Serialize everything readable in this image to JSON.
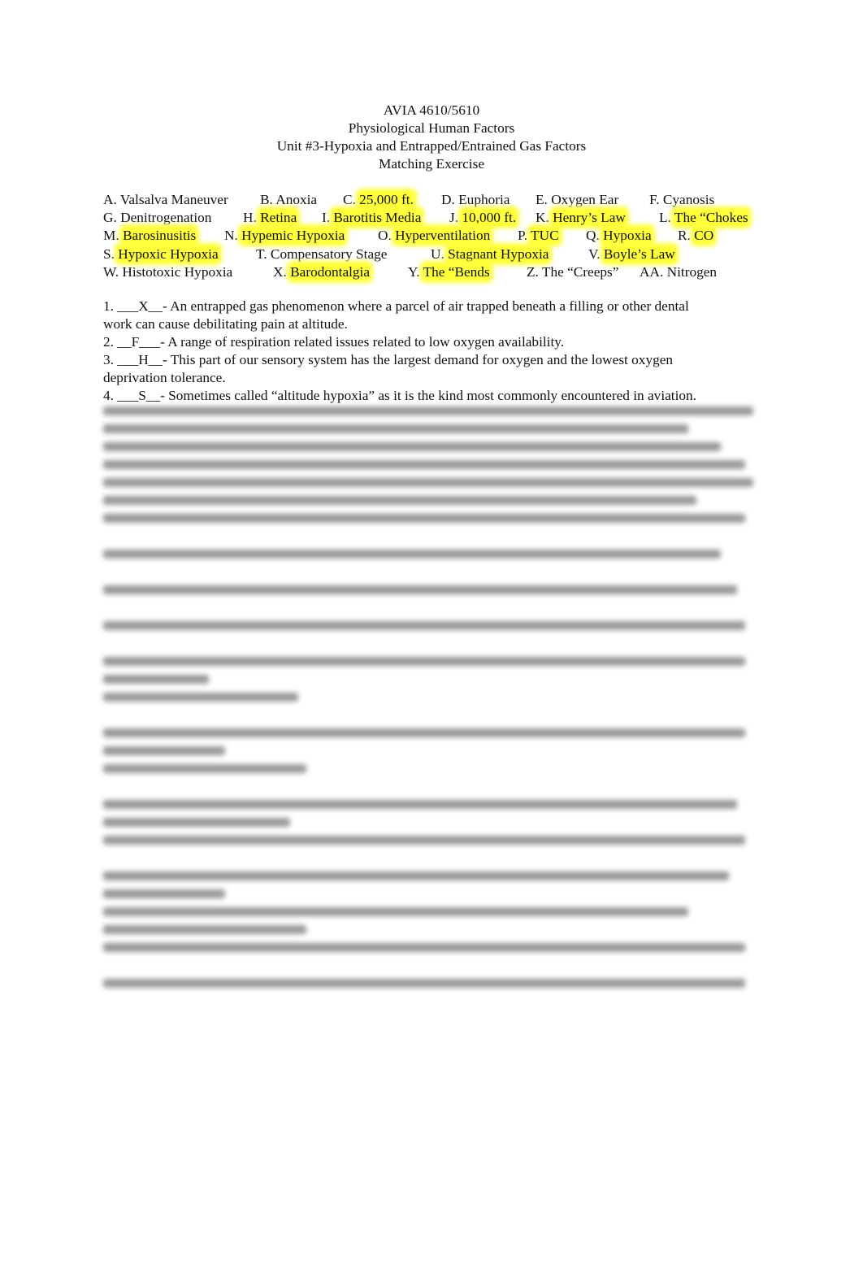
{
  "header": {
    "course": "AVIA 4610/5610",
    "subject": "Physiological Human Factors",
    "unit": "Unit #3-Hypoxia and Entrapped/Entrained Gas Factors",
    "exercise": "Matching Exercise"
  },
  "highlight_color": "#ffff3a",
  "bank": [
    [
      {
        "letter": "A.",
        "term": "Valsalva Maneuver",
        "hl": false
      },
      {
        "letter": "B.",
        "term": "Anoxia",
        "hl": false
      },
      {
        "letter": "C.",
        "term": "25,000 ft.",
        "hl": true
      },
      {
        "letter": "D.",
        "term": "Euphoria",
        "hl": false
      },
      {
        "letter": "E.",
        "term": "Oxygen Ear",
        "hl": false
      },
      {
        "letter": "F.",
        "term": "Cyanosis",
        "hl": false
      }
    ],
    [
      {
        "letter": "G.",
        "term": "Denitrogenation",
        "hl": false
      },
      {
        "letter": "H.",
        "term": "Retina",
        "hl": true
      },
      {
        "letter": "I.",
        "term": "Barotitis Media",
        "hl": true
      },
      {
        "letter": "J.",
        "term": "10,000 ft.",
        "hl": true
      },
      {
        "letter": "K.",
        "term": "Henry’s Law",
        "hl": true
      },
      {
        "letter": "L.",
        "term": "The “Chokes",
        "hl": true
      }
    ],
    [
      {
        "letter": "M.",
        "term": "Barosinusitis",
        "hl": true
      },
      {
        "letter": "N.",
        "term": "Hypemic Hypoxia",
        "hl": true
      },
      {
        "letter": "O.",
        "term": "Hyperventilation",
        "hl": true
      },
      {
        "letter": "P.",
        "term": "TUC",
        "hl": true
      },
      {
        "letter": "Q.",
        "term": "Hypoxia",
        "hl": true
      },
      {
        "letter": "R.",
        "term": "CO",
        "hl": true
      }
    ],
    [
      {
        "letter": "S.",
        "term": "Hypoxic Hypoxia",
        "hl": true
      },
      {
        "letter": "T.",
        "term": "Compensatory Stage",
        "hl": false
      },
      {
        "letter": "U.",
        "term": "Stagnant Hypoxia",
        "hl": true
      },
      {
        "letter": "V.",
        "term": "Boyle’s Law",
        "hl": true
      }
    ],
    [
      {
        "letter": "W.",
        "term": "Histotoxic Hypoxia",
        "hl": false
      },
      {
        "letter": "X.",
        "term": "Barodontalgia",
        "hl": true
      },
      {
        "letter": "Y.",
        "term": "The “Bends",
        "hl": true
      },
      {
        "letter": "Z.",
        "term": "The “Creeps”",
        "hl": false
      },
      {
        "letter": "AA.",
        "term": "Nitrogen",
        "hl": false
      }
    ]
  ],
  "questions": [
    {
      "num": "1.",
      "answer": "___X__",
      "text": "- An entrapped gas phenomenon where a parcel of air trapped beneath a filling or other dental",
      "cont": "work can cause debilitating pain at altitude."
    },
    {
      "num": "2.",
      "answer": "__F___",
      "text": "- A range of respiration related issues related to low oxygen availability.",
      "cont": ""
    },
    {
      "num": "3.",
      "answer": "___H__",
      "text": "- This part of our sensory system has the largest demand for oxygen and the lowest oxygen",
      "cont": "deprivation tolerance."
    },
    {
      "num": "4.",
      "answer": "___S__",
      "text": "- Sometimes called “altitude hypoxia” as it is the kind most commonly encountered in aviation.",
      "cont": ""
    }
  ],
  "blurred_note": "Questions 5–18 are obscured (blurred) in the screenshot"
}
